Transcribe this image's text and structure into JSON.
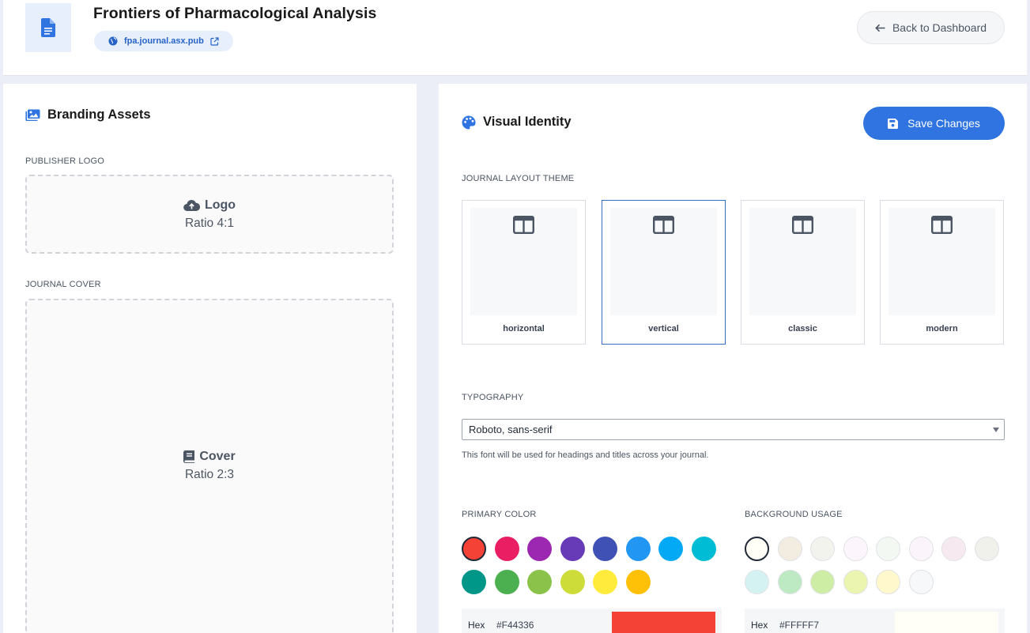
{
  "header": {
    "title": "Frontiers of Pharmacological Analysis",
    "url": "fpa.journal.asx.pub",
    "back_label": "Back to Dashboard"
  },
  "branding": {
    "title": "Branding Assets",
    "logo_section": "PUBLISHER LOGO",
    "logo_title": "Logo",
    "logo_ratio": "Ratio 4:1",
    "cover_section": "JOURNAL COVER",
    "cover_title": "Cover",
    "cover_ratio": "Ratio 2:3"
  },
  "identity": {
    "title": "Visual Identity",
    "save_label": "Save Changes",
    "layout_section": "JOURNAL LAYOUT THEME",
    "themes": [
      "horizontal",
      "vertical",
      "classic",
      "modern"
    ],
    "selected_theme": "vertical",
    "typography_section": "TYPOGRAPHY",
    "font_value": "Roboto, sans-serif",
    "font_hint": "This font will be used for headings and titles across your journal.",
    "primary_section": "PRIMARY COLOR",
    "background_section": "BACKGROUND USAGE",
    "hex_label": "Hex",
    "primary_hex": "#F44336",
    "background_hex": "#FFFFF7"
  },
  "colors": {
    "accent": "#2f74e0",
    "primary_swatches": [
      "#f44336",
      "#e91e63",
      "#9c27b0",
      "#673ab7",
      "#3f51b5",
      "#2196f3",
      "#03a9f4",
      "#00bcd4",
      "#009688",
      "#4caf50",
      "#8bc34a",
      "#cddc39",
      "#ffeb3b",
      "#ffc107"
    ],
    "background_swatches": [
      "#fffff7",
      "#f3ece0",
      "#f3f3ee",
      "#fcf6fc",
      "#f3f8f3",
      "#fbf4fb",
      "#f6eaf0",
      "#eff1ea",
      "#d3f2f1",
      "#bde9c3",
      "#cdeca4",
      "#ecf5b0",
      "#fff8cc",
      "#f6f8fa"
    ]
  }
}
